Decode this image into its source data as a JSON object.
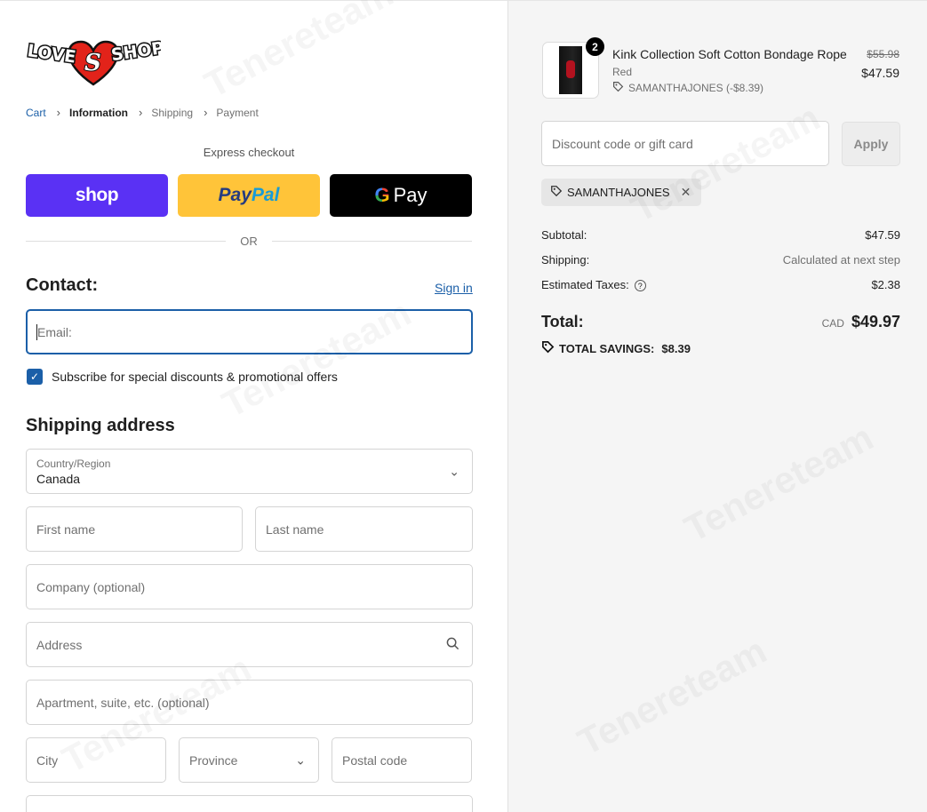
{
  "brand": {
    "logo_left": "LOVE",
    "logo_mid": "S",
    "logo_right": "SHOP"
  },
  "breadcrumb": {
    "items": [
      {
        "label": "Cart"
      },
      {
        "label": "Information"
      },
      {
        "label": "Shipping"
      },
      {
        "label": "Payment"
      }
    ]
  },
  "express": {
    "title": "Express checkout",
    "shop_label": "shop",
    "paypal_label_1": "Pay",
    "paypal_label_2": "Pal",
    "gpay_g": "G",
    "gpay_label": "Pay",
    "or_label": "OR"
  },
  "contact": {
    "heading": "Contact:",
    "signin_label": "Sign in",
    "email_placeholder": "Email:",
    "subscribe_label": "Subscribe for special discounts & promotional offers",
    "subscribe_checked": true
  },
  "shipping": {
    "heading": "Shipping address",
    "country_label": "Country/Region",
    "country_value": "Canada",
    "first_name_placeholder": "First name",
    "last_name_placeholder": "Last name",
    "company_placeholder": "Company (optional)",
    "address_placeholder": "Address",
    "apartment_placeholder": "Apartment, suite, etc. (optional)",
    "city_placeholder": "City",
    "province_placeholder": "Province",
    "postal_placeholder": "Postal code"
  },
  "cart": {
    "item": {
      "quantity": "2",
      "name": "Kink Collection Soft Cotton Bondage Rope",
      "variant": "Red",
      "discount": "SAMANTHAJONES (-$8.39)",
      "old_price": "$55.98",
      "price": "$47.59"
    },
    "discount_placeholder": "Discount code or gift card",
    "apply_label": "Apply",
    "applied_code": "SAMANTHAJONES",
    "subtotal_label": "Subtotal:",
    "subtotal_value": "$47.59",
    "shipping_label": "Shipping:",
    "shipping_value": "Calculated at next step",
    "taxes_label": "Estimated Taxes:",
    "taxes_value": "$2.38",
    "total_label": "Total:",
    "total_currency": "CAD",
    "total_value": "$49.97",
    "savings_label": "TOTAL SAVINGS:",
    "savings_value": "$8.39"
  },
  "watermark": "Tenereteam",
  "colors": {
    "accent": "#1b5fa8",
    "shop_purple": "#5a31f4",
    "paypal_yellow": "#ffc439"
  }
}
